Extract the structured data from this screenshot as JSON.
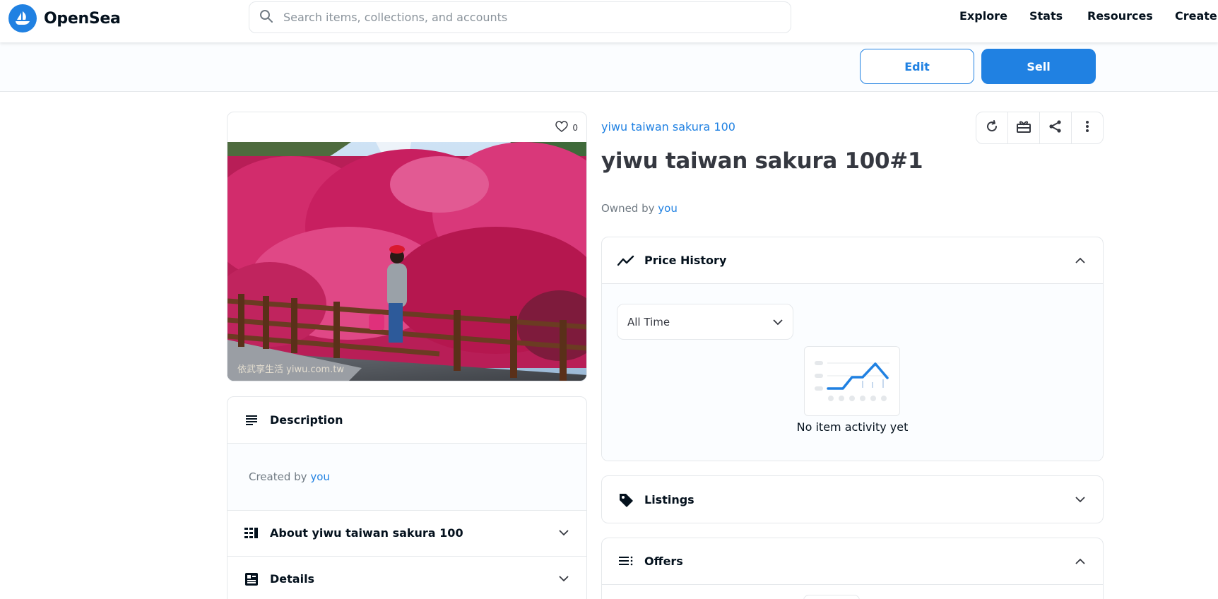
{
  "nav": {
    "brand": "OpenSea",
    "search_placeholder": "Search items, collections, and accounts",
    "links": [
      "Explore",
      "Stats",
      "Resources",
      "Create"
    ]
  },
  "actions": {
    "edit_label": "Edit",
    "sell_label": "Sell"
  },
  "media": {
    "favorites_count": "0",
    "photo_watermark": "依武享生活 yiwu.com.tw"
  },
  "item": {
    "collection": "yiwu taiwan sakura 100",
    "title": "yiwu taiwan sakura 100#1",
    "owned_prefix": "Owned by",
    "owner": "you"
  },
  "left_panels": {
    "description_title": "Description",
    "created_prefix": "Created by",
    "creator": "you",
    "about_title": "About yiwu taiwan sakura 100",
    "details_title": "Details"
  },
  "price_history": {
    "title": "Price History",
    "range_selected": "All Time",
    "empty_text": "No item activity yet"
  },
  "listings": {
    "title": "Listings"
  },
  "offers": {
    "title": "Offers"
  },
  "colors": {
    "accent": "#2081e2",
    "text_dark": "#04111d",
    "text_muted": "#707a83",
    "border": "#e5e8eb"
  }
}
